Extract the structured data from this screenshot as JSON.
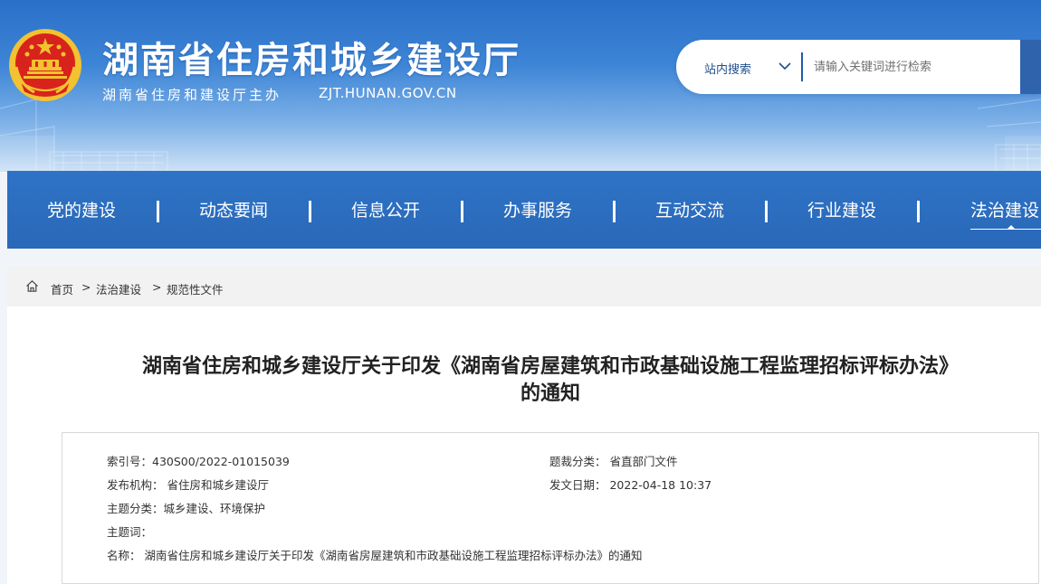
{
  "header": {
    "site_title": "湖南省住房和城乡建设厅",
    "subtitle": "湖南省住房和建设厅主办",
    "domain": "ZJT.HUNAN.GOV.CN"
  },
  "search": {
    "scope_label": "站内搜索",
    "placeholder": "请输入关键词进行检索"
  },
  "nav": {
    "items": [
      {
        "label": "党的建设"
      },
      {
        "label": "动态要闻"
      },
      {
        "label": "信息公开"
      },
      {
        "label": "办事服务"
      },
      {
        "label": "互动交流"
      },
      {
        "label": "行业建设"
      },
      {
        "label": "法治建设"
      }
    ],
    "active_index": 6
  },
  "breadcrumb": {
    "items": [
      "首页",
      "法治建设",
      "规范性文件"
    ],
    "separator": ">"
  },
  "article": {
    "title_line1": "湖南省住房和城乡建设厅关于印发《湖南省房屋建筑和市政基础设施工程监理招标评标办法》",
    "title_line2": "的通知"
  },
  "meta": {
    "index_no": "索引号：430S00/2022-01015039",
    "category": "题裁分类：  省直部门文件",
    "publisher": "发布机构：  省住房和城乡建设厅",
    "date": "发文日期：  2022-04-18 10:37",
    "topic": "主题分类：城乡建设、环境保护",
    "keywords": "主题词：",
    "name": "名称：  湖南省住房和城乡建设厅关于印发《湖南省房屋建筑和市政基础设施工程监理招标评标办法》的通知"
  },
  "colors": {
    "nav_blue": "#2e73c6",
    "header_blue": "#2a6fc9",
    "emblem_red": "#d8231c",
    "emblem_gold": "#f2c230"
  },
  "icons": {
    "emblem": "national-emblem",
    "search_dropdown": "chevron-down-icon",
    "breadcrumb_home": "home-icon"
  }
}
